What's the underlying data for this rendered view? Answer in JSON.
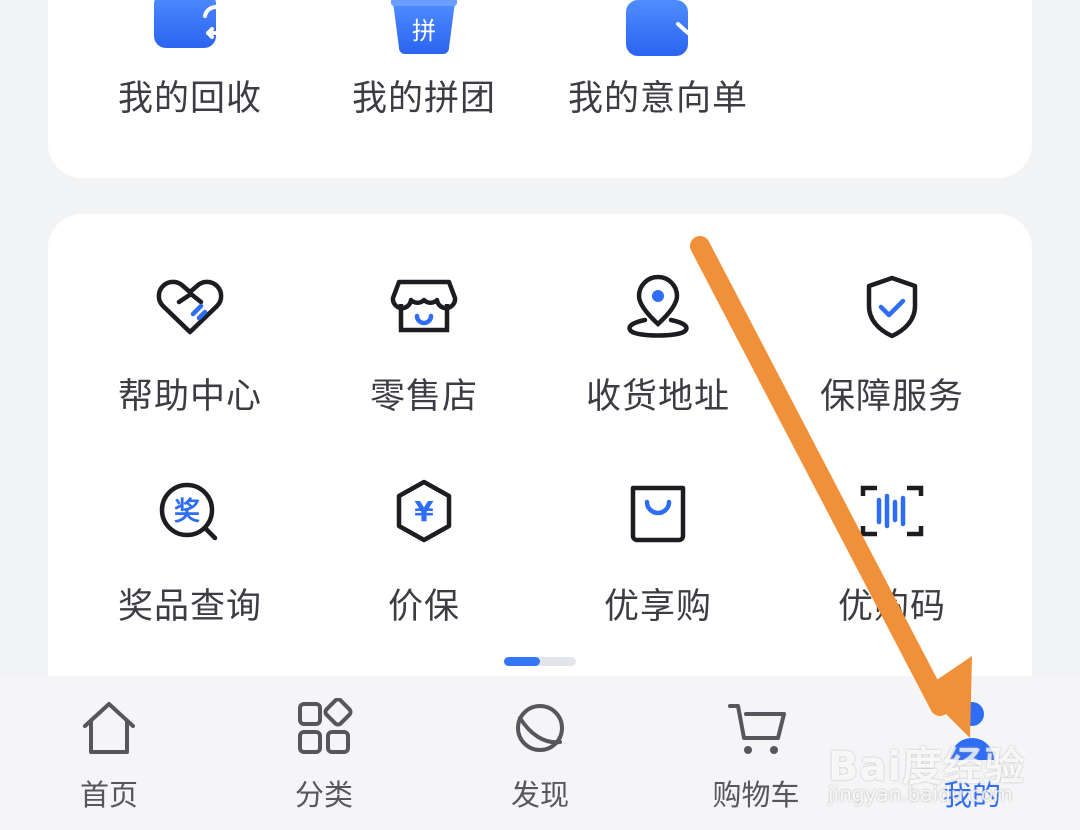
{
  "top_row": [
    {
      "label": "我的回收",
      "icon": "recycle-icon"
    },
    {
      "label": "我的拼团",
      "icon": "group-buy-bag-icon",
      "glyph": "拼"
    },
    {
      "label": "我的意向单",
      "icon": "intent-list-icon"
    }
  ],
  "services": [
    {
      "label": "帮助中心",
      "icon": "handshake-heart-icon"
    },
    {
      "label": "零售店",
      "icon": "store-icon"
    },
    {
      "label": "收货地址",
      "icon": "location-pin-icon"
    },
    {
      "label": "保障服务",
      "icon": "shield-check-icon"
    },
    {
      "label": "奖品查询",
      "icon": "prize-search-icon",
      "glyph": "奖"
    },
    {
      "label": "价保",
      "icon": "price-protect-icon",
      "glyph": "¥"
    },
    {
      "label": "优享购",
      "icon": "shopping-bag-icon"
    },
    {
      "label": "优购码",
      "icon": "scan-code-icon"
    }
  ],
  "pager": {
    "pages": 2,
    "current": 1
  },
  "tabbar": [
    {
      "label": "首页",
      "icon": "home-icon"
    },
    {
      "label": "分类",
      "icon": "category-icon"
    },
    {
      "label": "发现",
      "icon": "planet-icon"
    },
    {
      "label": "购物车",
      "icon": "cart-icon"
    },
    {
      "label": "我的",
      "icon": "user-icon",
      "active": true
    }
  ],
  "watermark": {
    "brand": "Bai度经验",
    "url": "jingyan.baidu.com"
  },
  "colors": {
    "accent": "#2f6df5",
    "arrow": "#f0913a",
    "text": "#3b3d42"
  }
}
